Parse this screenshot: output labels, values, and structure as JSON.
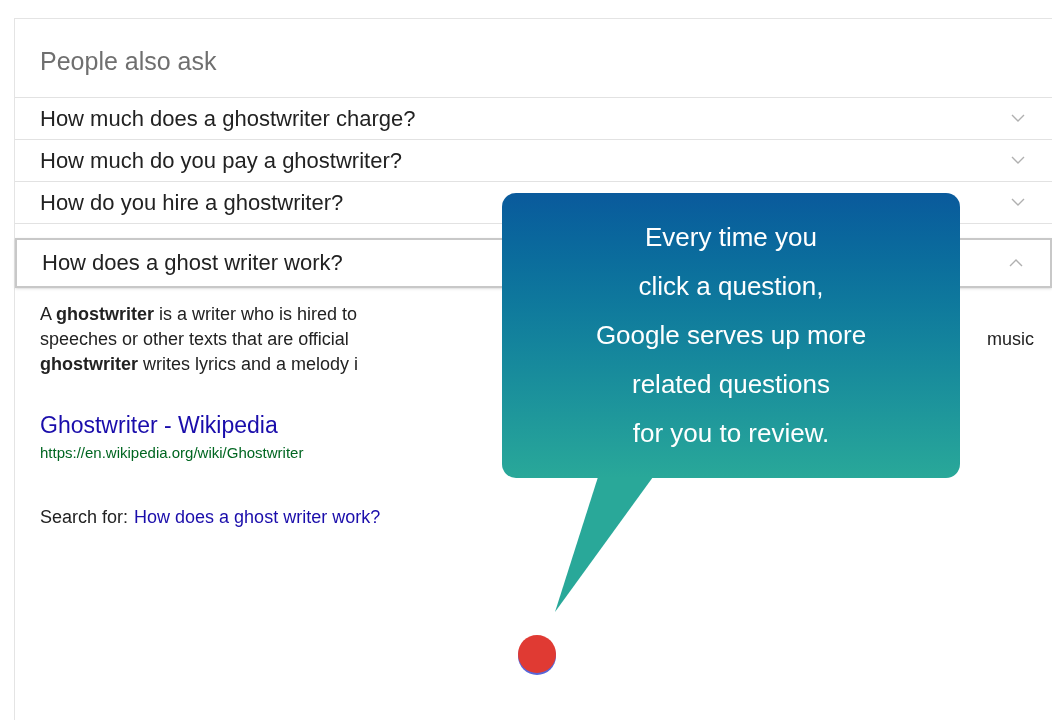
{
  "panel": {
    "title": "People also ask",
    "questions": [
      {
        "text": "How much does a ghostwriter charge?",
        "expanded": false
      },
      {
        "text": "How much do you pay a ghostwriter?",
        "expanded": false
      },
      {
        "text": "How do you hire a ghostwriter?",
        "expanded": false
      },
      {
        "text": "How does a ghost writer work?",
        "expanded": true
      }
    ],
    "answer": [
      {
        "left": "A **ghostwriter** is a writer who is hired to"
      },
      {
        "left": "speeches or other texts that are official",
        "right": "music"
      },
      {
        "left": "**ghostwriter** writes lyrics and a melody i"
      }
    ],
    "source": {
      "title": "Ghostwriter - Wikipedia",
      "url": "https://en.wikipedia.org/wiki/Ghostwriter"
    },
    "search_for": {
      "label": "Search for:",
      "query": "How does a ghost writer work?"
    }
  },
  "callout": {
    "lines": [
      "Every time you",
      "click a question,",
      "Google serves up more",
      "related questions",
      "for you to review."
    ]
  }
}
